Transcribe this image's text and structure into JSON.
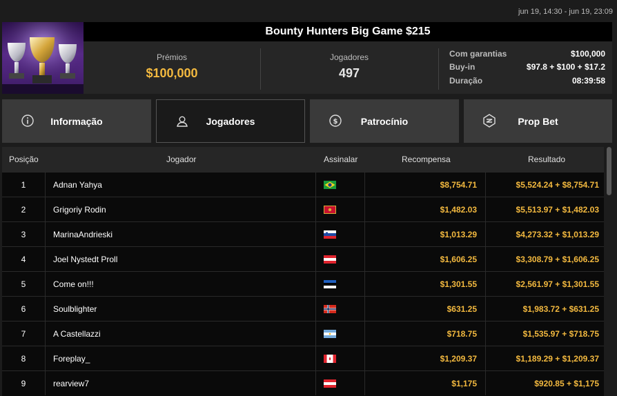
{
  "date_range": "jun 19, 14:30 - jun 19, 23:09",
  "tournament": {
    "title": "Bounty Hunters Big Game $215",
    "prize_label": "Prémios",
    "prize_value": "$100,000",
    "players_label": "Jogadores",
    "players_value": "497",
    "details": [
      {
        "key": "Com garantias",
        "value": "$100,000"
      },
      {
        "key": "Buy-in",
        "value": "$97.8 + $100 + $17.2"
      },
      {
        "key": "Duração",
        "value": "08:39:58"
      }
    ]
  },
  "tabs": [
    {
      "label": "Informação",
      "icon": "info-icon",
      "active": false
    },
    {
      "label": "Jogadores",
      "icon": "user-icon",
      "active": true
    },
    {
      "label": "Patrocínio",
      "icon": "dollar-coin-icon",
      "active": false
    },
    {
      "label": "Prop Bet",
      "icon": "prop-bet-icon",
      "active": false
    }
  ],
  "table": {
    "headers": {
      "position": "Posição",
      "player": "Jogador",
      "sign": "Assinalar",
      "reward": "Recompensa",
      "result": "Resultado"
    },
    "rows": [
      {
        "position": "1",
        "player": "Adnan Yahya",
        "country": "brazil",
        "reward": "$8,754.71",
        "result": "$5,524.24 + $8,754.71"
      },
      {
        "position": "2",
        "player": "Grigoriy Rodin",
        "country": "montenegro",
        "reward": "$1,482.03",
        "result": "$5,513.97 + $1,482.03"
      },
      {
        "position": "3",
        "player": "MarinaAndrieski",
        "country": "slovenia",
        "reward": "$1,013.29",
        "result": "$4,273.32 + $1,013.29"
      },
      {
        "position": "4",
        "player": "Joel Nystedt Proll",
        "country": "austria",
        "reward": "$1,606.25",
        "result": "$3,308.79 + $1,606.25"
      },
      {
        "position": "5",
        "player": "Come on!!!",
        "country": "estonia",
        "reward": "$1,301.55",
        "result": "$2,561.97 + $1,301.55"
      },
      {
        "position": "6",
        "player": "Soulblighter",
        "country": "norway",
        "reward": "$631.25",
        "result": "$1,983.72 + $631.25"
      },
      {
        "position": "7",
        "player": "A Castellazzi",
        "country": "argentina",
        "reward": "$718.75",
        "result": "$1,535.97 + $718.75"
      },
      {
        "position": "8",
        "player": "Foreplay_",
        "country": "canada",
        "reward": "$1,209.37",
        "result": "$1,189.29 + $1,209.37"
      },
      {
        "position": "9",
        "player": "rearview7",
        "country": "austria",
        "reward": "$1,175",
        "result": "$920.85 + $1,175"
      }
    ]
  },
  "colors": {
    "accent": "#f3b93f",
    "tab_bg": "#3a3a3a",
    "table_bg": "#0a0a0a"
  }
}
